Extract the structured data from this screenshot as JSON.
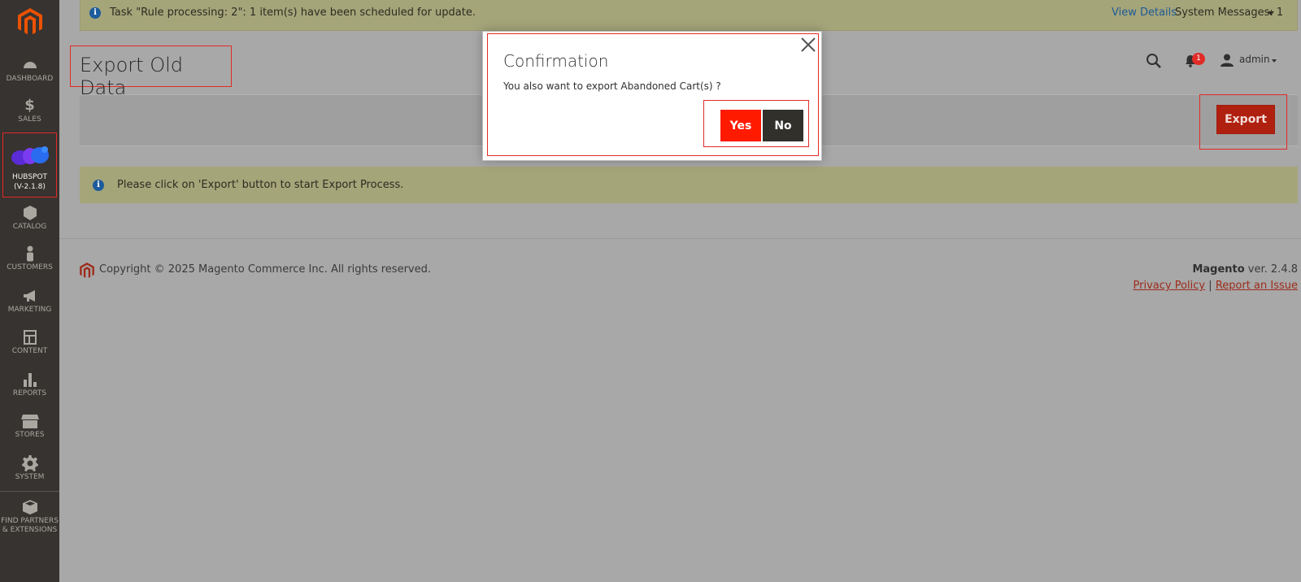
{
  "sidebar": {
    "items": [
      {
        "label": "DASHBOARD",
        "icon": "dashboard-icon"
      },
      {
        "label": "SALES",
        "icon": "dollar-icon"
      },
      {
        "label": "HUBSPOT",
        "sublabel": "(V-2.1.8)",
        "icon": "hubspot-logo-icon"
      },
      {
        "label": "CATALOG",
        "icon": "box-icon"
      },
      {
        "label": "CUSTOMERS",
        "icon": "person-icon"
      },
      {
        "label": "MARKETING",
        "icon": "megaphone-icon"
      },
      {
        "label": "CONTENT",
        "icon": "layout-icon"
      },
      {
        "label": "REPORTS",
        "icon": "bar-chart-icon"
      },
      {
        "label": "STORES",
        "icon": "store-icon"
      },
      {
        "label": "SYSTEM",
        "icon": "gear-icon"
      },
      {
        "label": "FIND PARTNERS",
        "sublabel": "& EXTENSIONS",
        "icon": "extensions-box-icon"
      }
    ]
  },
  "system_message": {
    "text": "Task \"Rule processing: 2\": 1 item(s) have been scheduled for update.",
    "view_details": "View Details",
    "count_label": "System Messages: 1"
  },
  "page": {
    "title": "Export Old Data",
    "export_label": "Export",
    "notice": "Please click on 'Export' button to start Export Process."
  },
  "header": {
    "notifications_count": "1",
    "user": "admin"
  },
  "modal": {
    "title": "Confirmation",
    "message": "You also want to export Abandoned Cart(s) ?",
    "yes_label": "Yes",
    "no_label": "No"
  },
  "footer": {
    "copyright": "Copyright © 2025 Magento Commerce Inc. All rights reserved.",
    "brand": "Magento",
    "version": " ver. 2.4.8",
    "privacy": "Privacy Policy",
    "separator": "|",
    "report": "Report an Issue"
  },
  "colors": {
    "accent": "#e02b27",
    "sidebar": "#373330",
    "yes_button": "#ff1a00",
    "no_button": "#31302b"
  }
}
